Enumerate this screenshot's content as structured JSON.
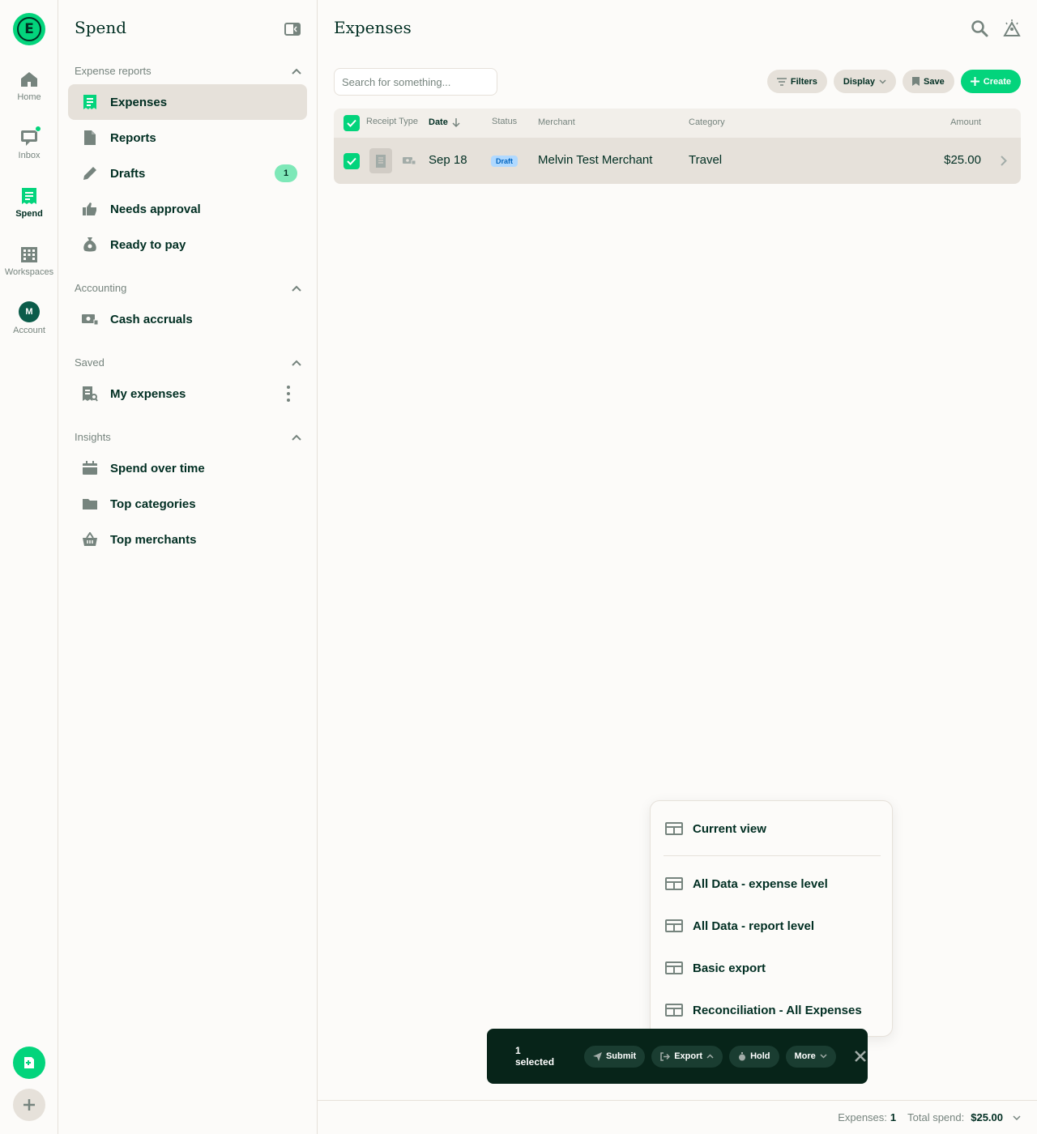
{
  "rail": {
    "items": [
      {
        "label": "Home",
        "icon": "home-icon"
      },
      {
        "label": "Inbox",
        "icon": "inbox-icon"
      },
      {
        "label": "Spend",
        "icon": "receipt-icon"
      },
      {
        "label": "Workspaces",
        "icon": "building-icon"
      },
      {
        "label": "Account",
        "icon": "avatar"
      }
    ],
    "avatar_initial": "M",
    "logo_letter": "E"
  },
  "sidebar": {
    "title": "Spend",
    "sections": {
      "expense_reports": "Expense reports",
      "accounting": "Accounting",
      "saved": "Saved",
      "insights": "Insights"
    },
    "items": {
      "expenses": "Expenses",
      "reports": "Reports",
      "drafts": "Drafts",
      "drafts_badge": "1",
      "needs_approval": "Needs approval",
      "ready_to_pay": "Ready to pay",
      "cash_accruals": "Cash accruals",
      "my_expenses": "My expenses",
      "spend_over_time": "Spend over time",
      "top_categories": "Top categories",
      "top_merchants": "Top merchants"
    }
  },
  "main": {
    "title": "Expenses",
    "search_placeholder": "Search for something...",
    "actions": {
      "filters": "Filters",
      "display": "Display",
      "save": "Save",
      "create": "Create"
    },
    "table": {
      "headers": {
        "receipt_type": "Receipt Type",
        "date": "Date",
        "status": "Status",
        "merchant": "Merchant",
        "category": "Category",
        "amount": "Amount"
      },
      "rows": [
        {
          "date": "Sep 18",
          "status": "Draft",
          "merchant": "Melvin Test Merchant",
          "category": "Travel",
          "amount": "$25.00"
        }
      ]
    }
  },
  "bulk_bar": {
    "selected": "1 selected",
    "submit": "Submit",
    "export": "Export",
    "hold": "Hold",
    "more": "More"
  },
  "export_menu": {
    "current_view": "Current view",
    "items": [
      "All Data - expense level",
      "All Data - report level",
      "Basic export",
      "Reconciliation - All Expenses"
    ]
  },
  "footer": {
    "expenses_label": "Expenses:",
    "expenses_count": "1",
    "total_label": "Total spend:",
    "total_value": "$25.00"
  },
  "colors": {
    "accent": "#03d47c",
    "text": "#002e22",
    "muted": "#76847e",
    "border": "#e6e1da",
    "bulk_bar": "#072419"
  }
}
